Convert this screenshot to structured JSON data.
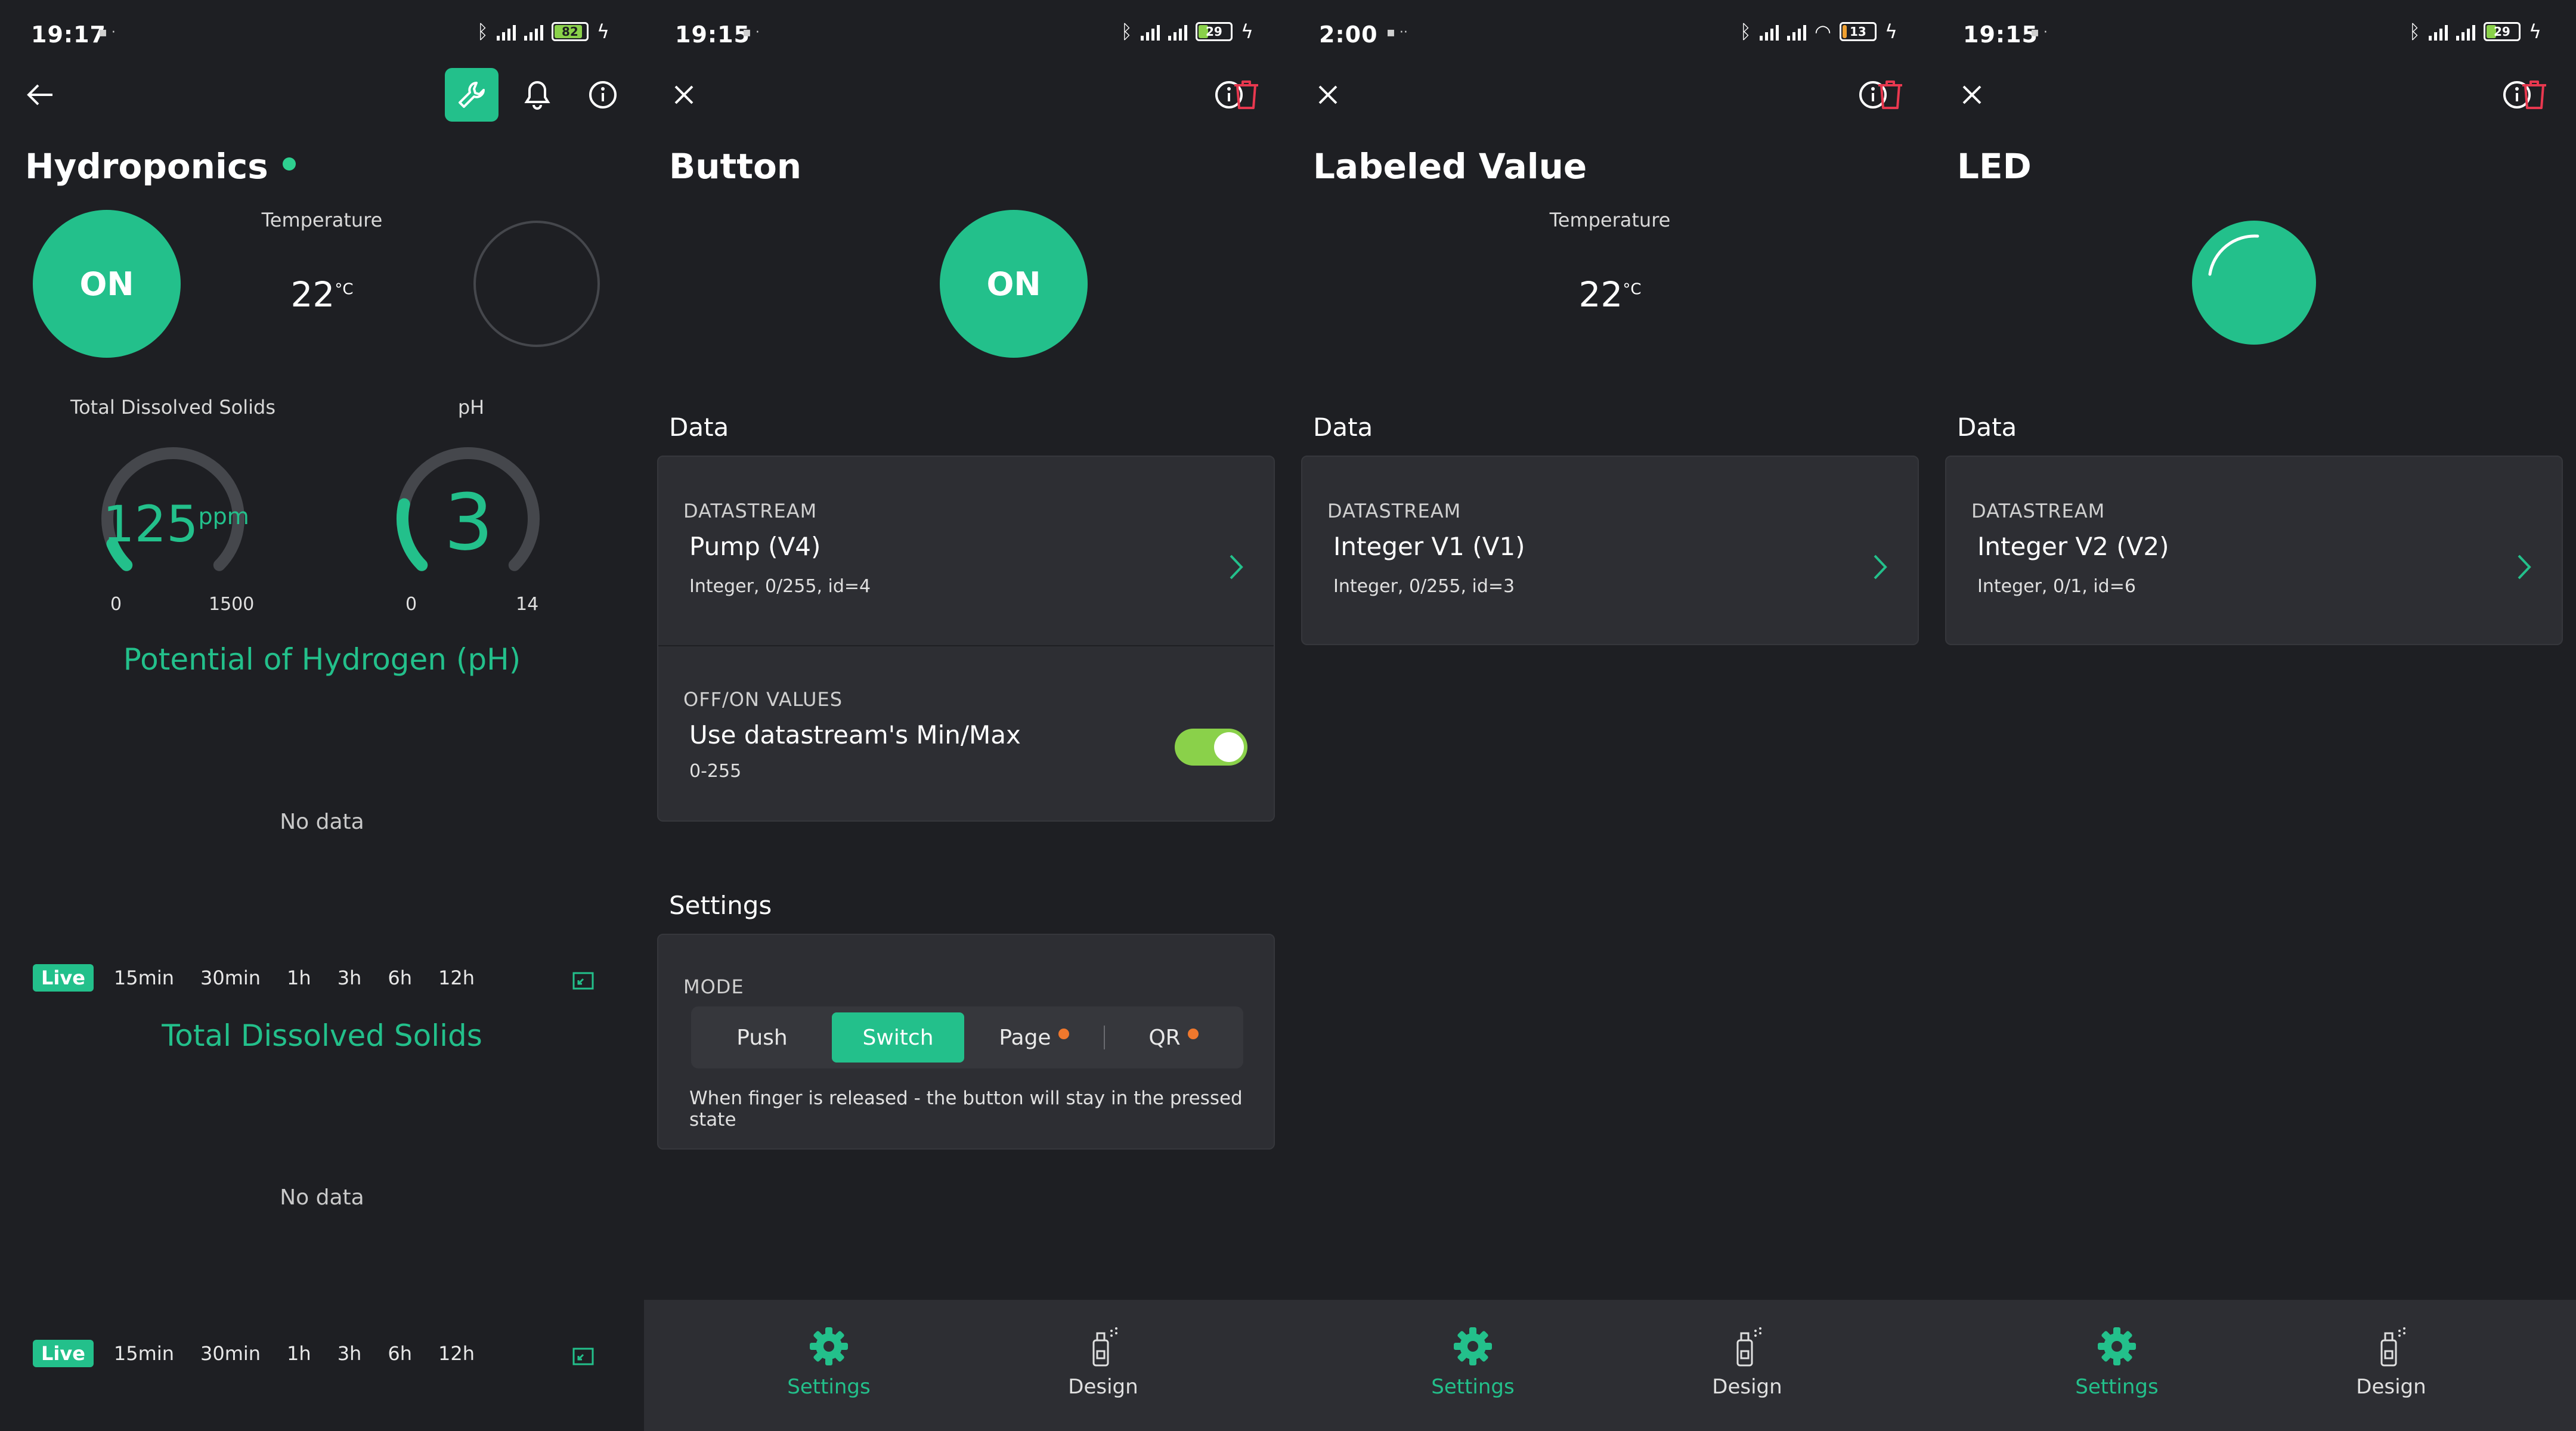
{
  "panels": [
    {
      "status": {
        "time": "19:17",
        "battery": "82"
      },
      "title": "Hydroponics",
      "button": {
        "label": "ON"
      },
      "labeled_value": {
        "label": "Temperature",
        "value": "22",
        "unit": "°C"
      },
      "gauges": [
        {
          "label": "Total Dissolved Solids",
          "value": "125",
          "unit": "ppm",
          "min": "0",
          "max": "1500",
          "fraction": 0.083
        },
        {
          "label": "pH",
          "value": "3",
          "unit": "",
          "min": "0",
          "max": "14",
          "fraction": 0.214
        }
      ],
      "charts": [
        {
          "title": "Potential of Hydrogen (pH)",
          "empty": "No data"
        },
        {
          "title": "Total Dissolved Solids",
          "empty": "No data"
        }
      ],
      "time_ranges": [
        "Live",
        "15min",
        "30min",
        "1h",
        "3h",
        "6h",
        "12h"
      ],
      "colors": {
        "accent": "#23c08b",
        "online": "#2ecf8f",
        "background": "#1e1f23"
      }
    },
    {
      "status": {
        "time": "19:15",
        "battery": "29"
      },
      "title": "Button",
      "preview_label": "ON",
      "data_section": "Data",
      "datastream": {
        "caption": "DATASTREAM",
        "name": "Pump (V4)",
        "details": "Integer, 0/255, id=4"
      },
      "values": {
        "caption": "OFF/ON VALUES",
        "label": "Use datastream's Min/Max",
        "range": "0-255",
        "enabled": true
      },
      "settings_section": "Settings",
      "mode": {
        "caption": "MODE",
        "options": [
          {
            "label": "Push",
            "active": false,
            "badge": false
          },
          {
            "label": "Switch",
            "active": true,
            "badge": false
          },
          {
            "label": "Page",
            "active": false,
            "badge": true
          },
          {
            "label": "QR",
            "active": false,
            "badge": true
          }
        ],
        "hint": "When finger is released - the button will stay in the pressed state"
      },
      "tabs": [
        {
          "label": "Settings",
          "active": true
        },
        {
          "label": "Design",
          "active": false
        }
      ]
    },
    {
      "status": {
        "time": "2:00",
        "battery": "13"
      },
      "title": "Labeled Value",
      "preview": {
        "label": "Temperature",
        "value": "22",
        "unit": "°C"
      },
      "data_section": "Data",
      "datastream": {
        "caption": "DATASTREAM",
        "name": "Integer V1 (V1)",
        "details": "Integer, 0/255, id=3"
      },
      "tabs": [
        {
          "label": "Settings",
          "active": true
        },
        {
          "label": "Design",
          "active": false
        }
      ]
    },
    {
      "status": {
        "time": "19:15",
        "battery": "29"
      },
      "title": "LED",
      "data_section": "Data",
      "datastream": {
        "caption": "DATASTREAM",
        "name": "Integer V2 (V2)",
        "details": "Integer, 0/1, id=6"
      },
      "tabs": [
        {
          "label": "Settings",
          "active": true
        },
        {
          "label": "Design",
          "active": false
        }
      ]
    }
  ]
}
